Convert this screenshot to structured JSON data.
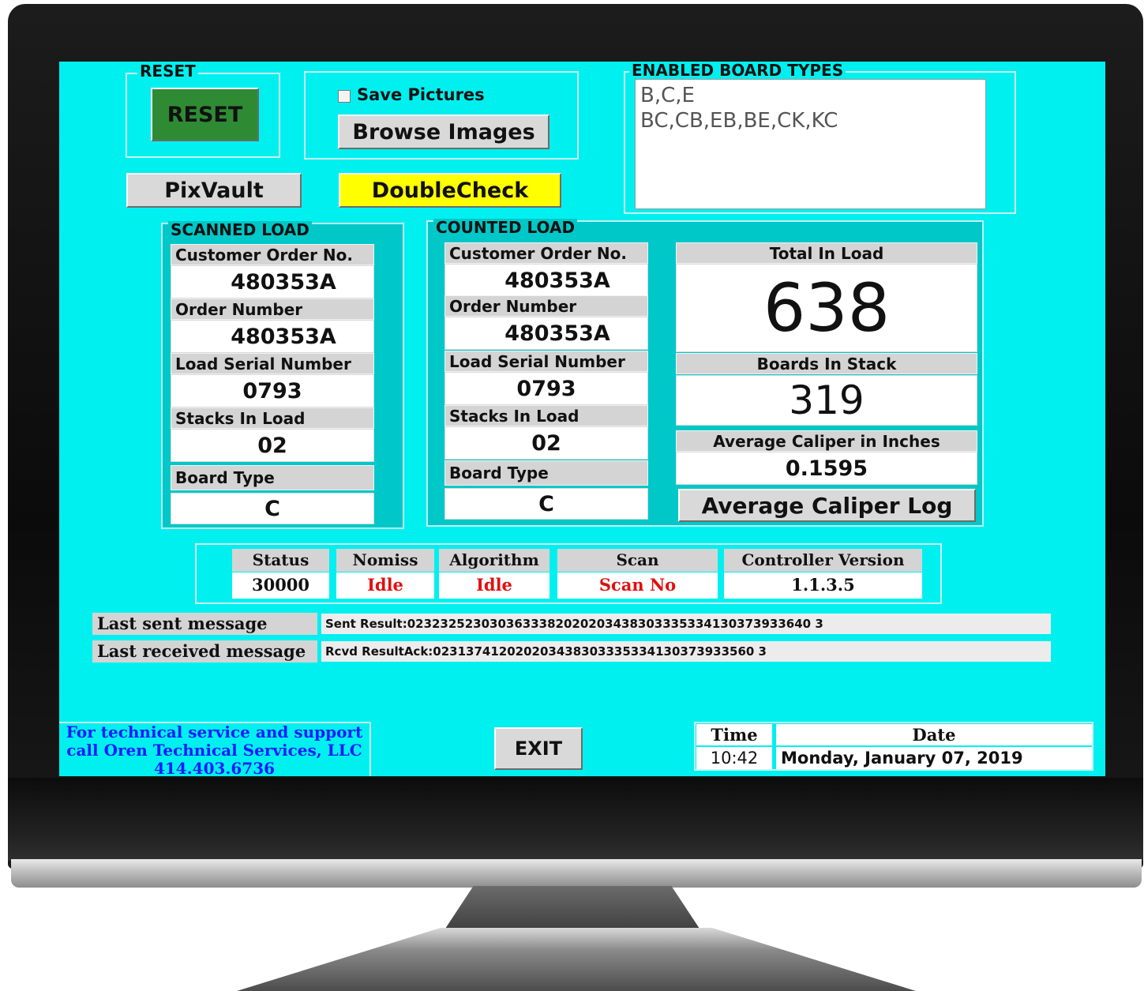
{
  "reset_group": {
    "title": "RESET",
    "button_label": "RESET"
  },
  "pictures": {
    "save_pictures_label": "Save Pictures",
    "save_pictures_checked": false,
    "browse_label": "Browse Images"
  },
  "buttons": {
    "pixvault": "PixVault",
    "doublecheck": "DoubleCheck",
    "avg_caliper_log": "Average Caliper Log",
    "exit": "EXIT"
  },
  "board_types": {
    "title": "ENABLED BOARD TYPES",
    "line1": "B,C,E",
    "line2": "BC,CB,EB,BE,CK,KC"
  },
  "scanned": {
    "title": "SCANNED LOAD",
    "customer_order_label": "Customer Order No.",
    "customer_order": "480353A",
    "order_number_label": "Order Number",
    "order_number": "480353A",
    "serial_label": "Load Serial Number",
    "serial": "0793",
    "stacks_label": "Stacks In Load",
    "stacks": "02",
    "board_type_label": "Board Type",
    "board_type": "C"
  },
  "counted": {
    "title": "COUNTED LOAD",
    "customer_order_label": "Customer Order No.",
    "customer_order": "480353A",
    "order_number_label": "Order Number",
    "order_number": "480353A",
    "serial_label": "Load Serial Number",
    "serial": "0793",
    "stacks_label": "Stacks In Load",
    "stacks": "02",
    "board_type_label": "Board Type",
    "board_type": "C",
    "total_label": "Total In Load",
    "total": "638",
    "boards_stack_label": "Boards In Stack",
    "boards_stack": "319",
    "avg_caliper_label": "Average Caliper in Inches",
    "avg_caliper": "0.1595"
  },
  "status_bar": {
    "status_label": "Status",
    "status": "30000",
    "nomiss_label": "Nomiss",
    "nomiss": "Idle",
    "algorithm_label": "Algorithm",
    "algorithm": "Idle",
    "scan_label": "Scan",
    "scan": "Scan No",
    "controller_label": "Controller Version",
    "controller": "1.1.3.5"
  },
  "messages": {
    "sent_label": "Last sent message",
    "sent": "Sent Result:0232325230303633382020203438303335334130373933640 3",
    "received_label": "Last received message",
    "received": "Rcvd ResultAck:023137412020203438303335334130373933560 3"
  },
  "support": {
    "line1": "For technical service and support",
    "line2": "call Oren Technical Services, LLC",
    "line3": "414.403.6736"
  },
  "datetime": {
    "time_label": "Time",
    "time": "10:42",
    "date_label": "Date",
    "date": "Monday, January 07, 2019"
  },
  "colors": {
    "screen_bg": "#00f0f0",
    "reset_green": "#2e8b34",
    "doublecheck_yellow": "#ffff00",
    "status_red": "#e01010",
    "support_blue": "#1a1aff"
  }
}
